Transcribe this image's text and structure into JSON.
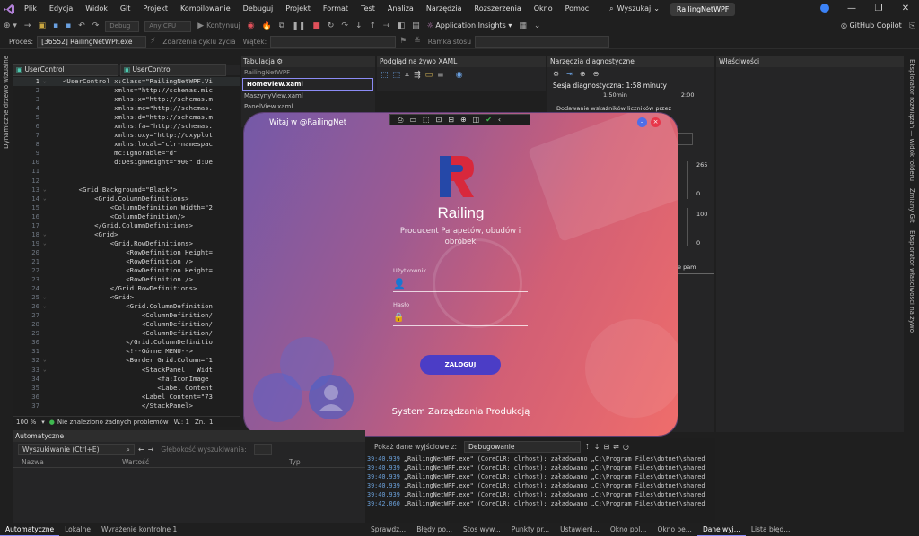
{
  "menubar": {
    "items": [
      "Plik",
      "Edycja",
      "Widok",
      "Git",
      "Projekt",
      "Kompilowanie",
      "Debuguj",
      "Projekt",
      "Format",
      "Test",
      "Analiza",
      "Narzędzia",
      "Rozszerzenia",
      "Okno",
      "Pomoc"
    ],
    "search_label": "Wyszukaj",
    "solution_name": "RailingNetWPF"
  },
  "toolbar1": {
    "config": "Debug",
    "platform": "Any CPU",
    "continue_label": "Kontynuuj",
    "app_insights": "Application Insights",
    "copilot": "GitHub Copilot"
  },
  "toolbar2": {
    "process_label": "Proces:",
    "process_value": "[36552] RailingNetWPF.exe",
    "lifecycle_label": "Zdarzenia cyklu życia",
    "thread_label": "Wątek:",
    "stack_label": "Ramka stosu"
  },
  "left_rail": "Dynamiczne drzewo wizualne",
  "right_rail": [
    "Eksplorator rozwiązań — widok folderu",
    "Zmiany Git",
    "Eksplorator właściwości na żywo"
  ],
  "editor": {
    "tabs": [
      "UserControl",
      "UserControl"
    ],
    "lines": [
      {
        "n": "1",
        "t": "<UserControl x:Class=\"RailingNetWPF.Vi"
      },
      {
        "n": "2",
        "t": "             xmlns=\"http://schemas.mic"
      },
      {
        "n": "3",
        "t": "             xmlns:x=\"http://schemas.m"
      },
      {
        "n": "4",
        "t": "             xmlns:mc=\"http://schemas."
      },
      {
        "n": "5",
        "t": "             xmlns:d=\"http://schemas.m"
      },
      {
        "n": "6",
        "t": "             xmlns:fa=\"http://schemas."
      },
      {
        "n": "7",
        "t": "             xmlns:oxy=\"http://oxyplot"
      },
      {
        "n": "8",
        "t": "             xmlns:local=\"clr-namespac"
      },
      {
        "n": "9",
        "t": "             mc:Ignorable=\"d\""
      },
      {
        "n": "10",
        "t": "             d:DesignHeight=\"900\" d:De"
      },
      {
        "n": "11",
        "t": ""
      },
      {
        "n": "12",
        "t": ""
      },
      {
        "n": "13",
        "t": "    <Grid Background=\"Black\">"
      },
      {
        "n": "14",
        "t": "        <Grid.ColumnDefinitions>"
      },
      {
        "n": "15",
        "t": "            <ColumnDefinition Width=\"2"
      },
      {
        "n": "16",
        "t": "            <ColumnDefinition/>"
      },
      {
        "n": "17",
        "t": "        </Grid.ColumnDefinitions>"
      },
      {
        "n": "18",
        "t": "        <Grid>"
      },
      {
        "n": "19",
        "t": "            <Grid.RowDefinitions>"
      },
      {
        "n": "20",
        "t": "                <RowDefinition Height="
      },
      {
        "n": "21",
        "t": "                <RowDefinition />"
      },
      {
        "n": "22",
        "t": "                <RowDefinition Height="
      },
      {
        "n": "23",
        "t": "                <RowDefinition />"
      },
      {
        "n": "24",
        "t": "            </Grid.RowDefinitions>"
      },
      {
        "n": "25",
        "t": "            <Grid>"
      },
      {
        "n": "26",
        "t": "                <Grid.ColumnDefinition"
      },
      {
        "n": "27",
        "t": "                    <ColumnDefinition/"
      },
      {
        "n": "28",
        "t": "                    <ColumnDefinition/"
      },
      {
        "n": "29",
        "t": "                    <ColumnDefinition/"
      },
      {
        "n": "30",
        "t": "                </Grid.ColumnDefinitio"
      },
      {
        "n": "31",
        "t": "                <!--Górne MENU-->"
      },
      {
        "n": "32",
        "t": "                <Border Grid.Column=\"1"
      },
      {
        "n": "33",
        "t": "                    <StackPanel   Widt"
      },
      {
        "n": "34",
        "t": "                        <fa:IconImage"
      },
      {
        "n": "35",
        "t": "                        <Label Content"
      },
      {
        "n": "36",
        "t": "                    <Label Content=\"73"
      },
      {
        "n": "37",
        "t": "                    </StackPanel>"
      }
    ],
    "zoom": "100 %",
    "status": "Nie znaleziono żadnych problemów",
    "line": "W.: 1",
    "col": "Zn.: 1"
  },
  "tabview": {
    "title": "Tabulacja",
    "project": "RailingNetWPF",
    "items": [
      "HomeView.xaml",
      "MaszynyView.xaml",
      "PanelView.xaml"
    ]
  },
  "live": {
    "title": "Podgląd na żywo XAML"
  },
  "diag": {
    "title": "Narzędzia diagnostyczne",
    "session": "Sesja diagnostyczna: 1:58 minuty",
    "t1": "1:50min",
    "t2": "2:00",
    "counters": "Dodawanie wskaźników liczników przez sprawdzanie",
    "v265": "265",
    "v0a": "0",
    "v100": "100",
    "v0b": "0",
    "trunc": "e pam"
  },
  "props": {
    "title": "Właściwości"
  },
  "app": {
    "welcome": "Witaj w @RailingNet",
    "brand": "Railing",
    "subtitle": "Producent Parapetów, obudów i obróbek",
    "user_label": "Użytkownik",
    "pass_label": "Hasło",
    "login_button": "ZALOGUJ",
    "footer": "System Zarządzania Produkcją",
    "colors": {
      "brand_red": "#d8283c",
      "brand_blue": "#2548a8",
      "button": "#4b3dc6"
    }
  },
  "autos": {
    "title": "Automatyczne",
    "search_placeholder": "Wyszukiwanie (Ctrl+E)",
    "depth_label": "Głębokość wyszukiwania:",
    "col_name": "Nazwa",
    "col_value": "Wartość",
    "col_type": "Typ"
  },
  "output": {
    "label": "Pokaż dane wyjściowe z:",
    "source": "Debugowanie",
    "lines": [
      {
        "time": "39:40.939",
        "text": " „RailingNetWPF.exe\" (CoreCLR: clrhost): załadowano „C:\\Program Files\\dotnet\\shared"
      },
      {
        "time": "39:40.939",
        "text": " „RailingNetWPF.exe\" (CoreCLR: clrhost): załadowano „C:\\Program Files\\dotnet\\shared"
      },
      {
        "time": "39:40.939",
        "text": " „RailingNetWPF.exe\" (CoreCLR: clrhost): załadowano „C:\\Program Files\\dotnet\\shared"
      },
      {
        "time": "39:40.939",
        "text": " „RailingNetWPF.exe\" (CoreCLR: clrhost): załadowano „C:\\Program Files\\dotnet\\shared"
      },
      {
        "time": "39:40.939",
        "text": " „RailingNetWPF.exe\" (CoreCLR: clrhost): załadowano „C:\\Program Files\\dotnet\\shared"
      },
      {
        "time": "39:42.060",
        "text": " „RailingNetWPF.exe\" (CoreCLR: clrhost): załadowano „C:\\Program Files\\dotnet\\shared"
      }
    ]
  },
  "bottom_tabs_left": [
    "Automatyczne",
    "Lokalne",
    "Wyrażenie kontrolne 1"
  ],
  "bottom_tabs_right": [
    "Sprawdz...",
    "Błędy po...",
    "Stos wyw...",
    "Punkty pr...",
    "Ustawieni...",
    "Okno pol...",
    "Okno be...",
    "Dane wyj...",
    "Lista błęd..."
  ]
}
